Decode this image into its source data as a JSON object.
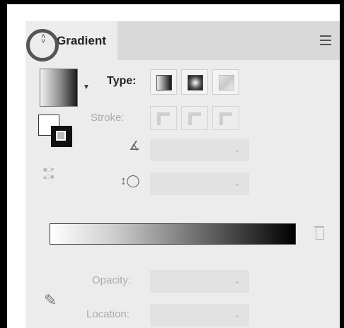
{
  "panel": {
    "tab_title": "Gradient",
    "tab_arrows_icon": "collapse-arrows-icon",
    "menu_icon": "hamburger-menu-icon"
  },
  "controls": {
    "type_label": "Type:",
    "stroke_label": "Stroke:",
    "opacity_label": "Opacity:",
    "location_label": "Location:"
  },
  "gradient": {
    "start_color": "#ffffff",
    "end_color": "#000000"
  },
  "icons": {
    "type_buttons": [
      "linear-gradient-icon",
      "radial-gradient-icon",
      "freeform-gradient-icon"
    ],
    "stroke_buttons": [
      "stroke-within-icon",
      "stroke-along-icon",
      "stroke-across-icon"
    ]
  }
}
